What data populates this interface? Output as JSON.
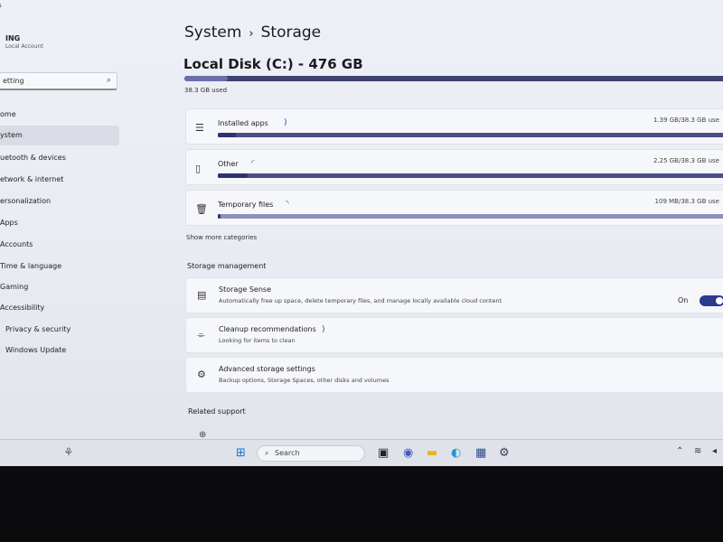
{
  "sidebar": {
    "top_fragment": "s",
    "user_name": "ING",
    "user_subtitle": "Local Account",
    "search_value": "etting",
    "items": [
      {
        "label": "ome"
      },
      {
        "label": "ystem"
      },
      {
        "label": "uetooth & devices"
      },
      {
        "label": "etwork & internet"
      },
      {
        "label": "ersonalization"
      },
      {
        "label": "Apps"
      },
      {
        "label": "Accounts"
      },
      {
        "label": "Time & language"
      },
      {
        "label": "Gaming"
      },
      {
        "label": "Accessibility"
      },
      {
        "label": "Privacy & security"
      },
      {
        "label": "Windows Update"
      }
    ]
  },
  "header": {
    "breadcrumb_parent": "System",
    "breadcrumb_sep": "›",
    "breadcrumb_current": "Storage"
  },
  "disk": {
    "title": "Local Disk (C:) - 476 GB",
    "used_text": "38.3 GB used",
    "used_fraction": 0.08
  },
  "categories": [
    {
      "label": "Installed apps",
      "size": "1.39 GB/38.3 GB use",
      "fill_fraction": 0.036,
      "icon": "list-icon"
    },
    {
      "label": "Other",
      "size": "2.25 GB/38.3 GB use",
      "fill_fraction": 0.059,
      "icon": "document-icon"
    },
    {
      "label": "Temporary files",
      "size": "109 MB/38.3 GB use",
      "fill_fraction": 0.003,
      "icon": "trash-icon"
    }
  ],
  "show_more": "Show more categories",
  "storage_management": {
    "heading": "Storage management",
    "items": [
      {
        "title": "Storage Sense",
        "subtitle": "Automatically free up space, delete temporary files, and manage locally available cloud content",
        "icon": "storage-icon"
      },
      {
        "title": "Cleanup recommendations",
        "subtitle": "Looking for items to clean",
        "icon": "broom-icon"
      },
      {
        "title": "Advanced storage settings",
        "subtitle": "Backup options, Storage Spaces, other disks and volumes",
        "icon": "gear-icon"
      }
    ],
    "toggle_label": "On",
    "toggle_on": true
  },
  "related": {
    "heading": "Related support"
  },
  "taskbar": {
    "search_placeholder": "Search"
  }
}
